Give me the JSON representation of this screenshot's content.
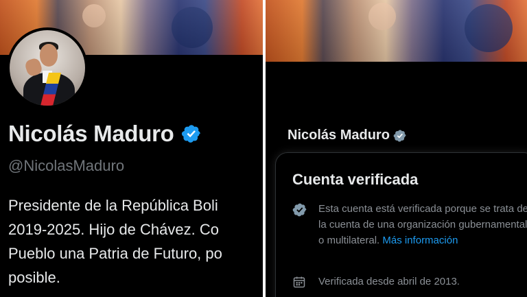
{
  "left_profile": {
    "name": "Nicolás Maduro",
    "handle": "@NicolasMaduro",
    "bio_lines": [
      "Presidente de la República Boli",
      "2019-2025. Hijo de Chávez. Co",
      "Pueblo una Patria de Futuro, po",
      "posible."
    ]
  },
  "right_profile": {
    "name": "Nicolás Maduro"
  },
  "verified_card": {
    "title": "Cuenta verificada",
    "description": "Esta cuenta está verificada porque se trata de la cuenta de una organización gubernamental o multilateral.",
    "link_text": "Más información",
    "since_text": "Verificada desde abril de 2013."
  },
  "colors": {
    "background": "#000000",
    "text_primary": "#e7e9ea",
    "text_secondary": "#71767b",
    "link": "#1d9bf0",
    "verified_badge": "#1d9bf0",
    "gov_badge": "#829aab"
  },
  "icons": {
    "verified": "verified-badge-icon",
    "calendar": "calendar-icon"
  }
}
